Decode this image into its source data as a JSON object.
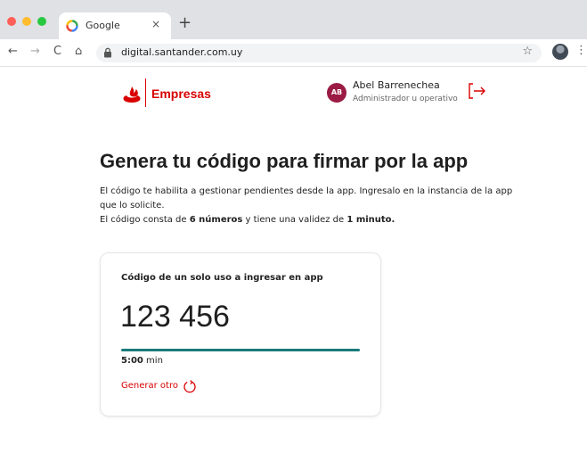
{
  "browser": {
    "tab_title": "Google",
    "tab_close": "×",
    "new_tab": "+",
    "back": "←",
    "forward": "→",
    "reload": "C",
    "home": "⌂",
    "url": "digital.santander.com.uy",
    "bookmark": "☆",
    "menu": "⋮"
  },
  "header": {
    "brand": "Empresas",
    "avatar_initials": "AB",
    "user_name": "Abel Barrenechea",
    "user_role": "Administrador u operativo"
  },
  "main": {
    "title": "Genera tu código para firmar por la app",
    "desc_line1": "El código te habilita a gestionar pendientes desde la app. Ingresalo en la instancia de la app que lo solicite.",
    "desc_line2_pre": "El código consta de ",
    "desc_line2_b1": "6 números",
    "desc_line2_mid": " y tiene una validez de ",
    "desc_line2_b2": "1 minuto."
  },
  "card": {
    "label": "Código de un solo uso a ingresar en app",
    "code": "123 456",
    "progress_fraction": 1.0,
    "timer_value": "5:00",
    "timer_unit": " min",
    "regen_label": "Generar otro"
  },
  "colors": {
    "brand_red": "#d80000",
    "progress": "#1a7a7a",
    "avatar": "#9b1b44"
  }
}
